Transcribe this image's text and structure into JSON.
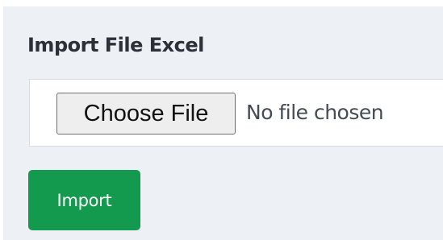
{
  "form": {
    "title": "Import File Excel",
    "file_input": {
      "button_label": "Choose File",
      "status_text": "No file chosen"
    },
    "submit_label": "Import"
  },
  "colors": {
    "panel_background": "#edf0f5",
    "primary_button": "#149a4e"
  }
}
